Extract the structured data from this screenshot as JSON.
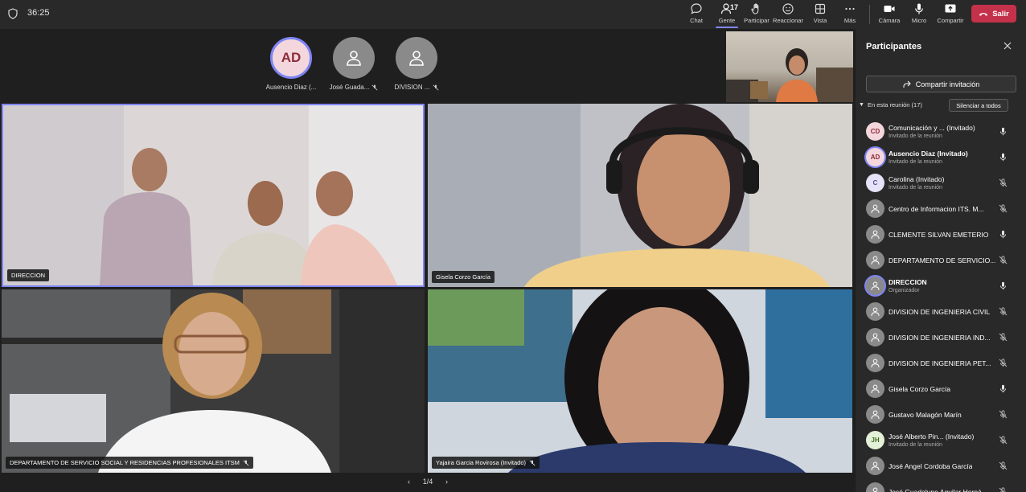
{
  "meeting": {
    "timer": "36:25"
  },
  "toolbar": {
    "chat": "Chat",
    "people": "Gente",
    "people_count": "17",
    "raise": "Participar",
    "react": "Reaccionar",
    "view": "Vista",
    "more": "Más",
    "camera": "Cámara",
    "mic": "Micro",
    "share": "Compartir",
    "leave": "Salir"
  },
  "stage": {
    "avatars": [
      {
        "initials": "AD",
        "name": "Ausencio Diaz (...",
        "muted": false
      },
      {
        "initials": "",
        "name": "José Guada...",
        "muted": true
      },
      {
        "initials": "",
        "name": "DIVISION ...",
        "muted": true
      }
    ],
    "tiles": [
      {
        "label": "DIRECCION",
        "muted": false
      },
      {
        "label": "Gisela Corzo García",
        "muted": false
      },
      {
        "label": "DEPARTAMENTO DE SERVICIO SOCIAL Y RESIDENCIAS PROFESIONALES ITSM",
        "muted": true
      },
      {
        "label": "Yajaira Garcia Rovirosa (Invitado)",
        "muted": true
      }
    ],
    "pager": "1/4"
  },
  "panel": {
    "title": "Participantes",
    "invite": "Compartir invitación",
    "section": "En esta reunión (17)",
    "mute_all": "Silenciar a todos",
    "participants": [
      {
        "initials": "CD",
        "name": "Comunicación y ... (Invitado)",
        "sub": "Invitado de la reunión",
        "mic": "on",
        "avatar_bg": "#f4d7dc",
        "avatar_fg": "#8d2c3c"
      },
      {
        "initials": "AD",
        "name": "Ausencio Diaz (Invitado)",
        "sub": "Invitado de la reunión",
        "mic": "on",
        "avatar_bg": "#f4d7dc",
        "avatar_fg": "#8d2c3c",
        "bold": true,
        "ring": true
      },
      {
        "initials": "C",
        "name": "Carolina (Invitado)",
        "sub": "Invitado de la reunión",
        "mic": "off",
        "avatar_bg": "#e6e2f8",
        "avatar_fg": "#4f4a9e"
      },
      {
        "initials": "",
        "name": "Centro de Informacion ITS. M...",
        "sub": "",
        "mic": "off"
      },
      {
        "initials": "",
        "name": "CLEMENTE SILVAN EMETERIO",
        "sub": "",
        "mic": "on"
      },
      {
        "initials": "",
        "name": "DEPARTAMENTO DE SERVICIO...",
        "sub": "",
        "mic": "off"
      },
      {
        "initials": "",
        "name": "DIRECCION",
        "sub": "Organizador",
        "mic": "on",
        "bold": true,
        "ring": true
      },
      {
        "initials": "",
        "name": "DIVISION DE INGENIERIA CIVIL",
        "sub": "",
        "mic": "off"
      },
      {
        "initials": "",
        "name": "DIVISION DE INGENIERIA IND...",
        "sub": "",
        "mic": "off"
      },
      {
        "initials": "",
        "name": "DIVISION DE INGENIERIA PET...",
        "sub": "",
        "mic": "off"
      },
      {
        "initials": "",
        "name": "Gisela Corzo García",
        "sub": "",
        "mic": "on"
      },
      {
        "initials": "",
        "name": "Gustavo Malagón Marín",
        "sub": "",
        "mic": "off"
      },
      {
        "initials": "JH",
        "name": "José Alberto Pin... (Invitado)",
        "sub": "Invitado de la reunión",
        "mic": "off",
        "avatar_bg": "#e3f1d8",
        "avatar_fg": "#3f6b22"
      },
      {
        "initials": "",
        "name": "José Angel Cordoba García",
        "sub": "",
        "mic": "off"
      },
      {
        "initials": "",
        "name": "José Guadalupe Aguilar Herná...",
        "sub": "",
        "mic": "off"
      }
    ]
  }
}
